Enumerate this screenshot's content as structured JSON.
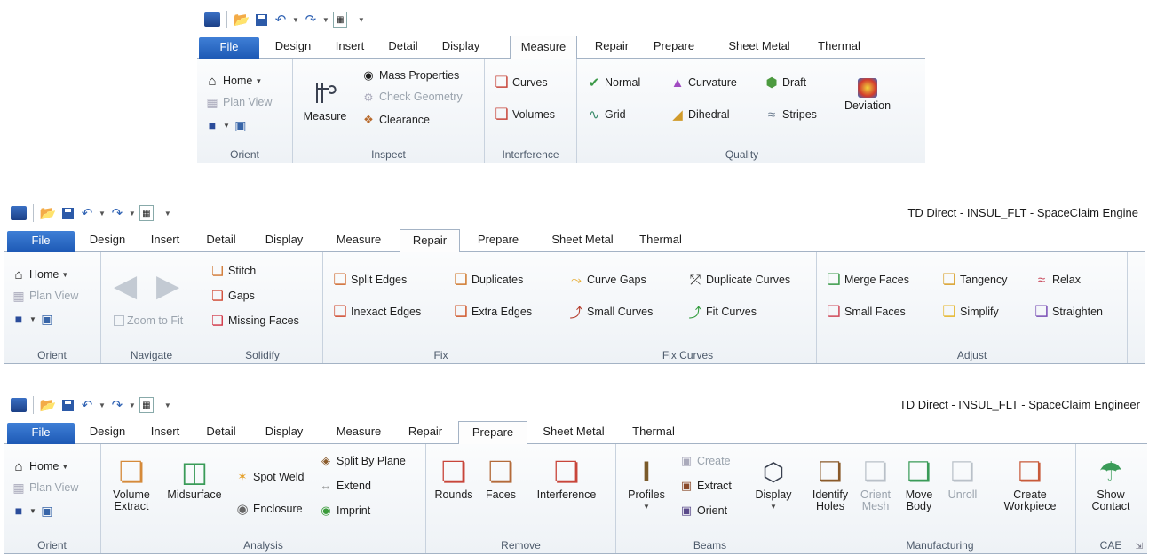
{
  "colors": {
    "file_tab": "#2a67c4",
    "ribbon_bg": "#f3f6f9",
    "border": "#a4b3c5"
  },
  "qat": {
    "save_icon": "save-icon",
    "undo_icon": "undo-icon",
    "redo_icon": "redo-icon"
  },
  "tabs": [
    "File",
    "Design",
    "Insert",
    "Detail",
    "Display",
    "Measure",
    "Repair",
    "Prepare",
    "Sheet Metal",
    "Thermal"
  ],
  "orient": {
    "home": "Home",
    "plan_view": "Plan View",
    "label": "Orient"
  },
  "s1": {
    "inspect": {
      "measure": "Measure",
      "mass_properties": "Mass Properties",
      "check_geometry": "Check Geometry",
      "clearance": "Clearance",
      "label": "Inspect"
    },
    "interference": {
      "curves": "Curves",
      "volumes": "Volumes",
      "label": "Interference"
    },
    "quality": {
      "normal": "Normal",
      "grid": "Grid",
      "curvature": "Curvature",
      "dihedral": "Dihedral",
      "draft": "Draft",
      "stripes": "Stripes",
      "deviation": "Deviation",
      "label": "Quality"
    }
  },
  "s2": {
    "title": "TD Direct - INSUL_FLT - SpaceClaim Engine",
    "navigate": {
      "zoom_to_fit": "Zoom to Fit",
      "label": "Navigate"
    },
    "solidify": {
      "stitch": "Stitch",
      "gaps": "Gaps",
      "missing_faces": "Missing Faces",
      "label": "Solidify"
    },
    "fix": {
      "split_edges": "Split Edges",
      "inexact_edges": "Inexact Edges",
      "duplicates": "Duplicates",
      "extra_edges": "Extra Edges",
      "label": "Fix"
    },
    "fix_curves": {
      "curve_gaps": "Curve Gaps",
      "small_curves": "Small Curves",
      "duplicate_curves": "Duplicate Curves",
      "fit_curves": "Fit Curves",
      "label": "Fix Curves"
    },
    "adjust": {
      "merge_faces": "Merge Faces",
      "small_faces": "Small Faces",
      "tangency": "Tangency",
      "simplify": "Simplify",
      "relax": "Relax",
      "straighten": "Straighten",
      "label": "Adjust"
    }
  },
  "s3": {
    "title": "TD Direct - INSUL_FLT - SpaceClaim Engineer",
    "analysis": {
      "volume": "Volume",
      "extract": "Extract",
      "midsurface": "Midsurface",
      "spot_weld": "Spot Weld",
      "enclosure": "Enclosure",
      "split_by_plane": "Split By Plane",
      "extend": "Extend",
      "imprint": "Imprint",
      "label": "Analysis"
    },
    "remove": {
      "rounds": "Rounds",
      "faces": "Faces",
      "interference": "Interference",
      "label": "Remove"
    },
    "beams": {
      "profiles": "Profiles",
      "create": "Create",
      "extract": "Extract",
      "orient": "Orient",
      "display": "Display",
      "label": "Beams"
    },
    "manufacturing": {
      "identify": "Identify",
      "holes": "Holes",
      "orient": "Orient",
      "mesh": "Mesh",
      "move": "Move",
      "body": "Body",
      "unroll": "Unroll",
      "create": "Create",
      "workpiece": "Workpiece",
      "label": "Manufacturing"
    },
    "cae": {
      "show": "Show",
      "contact": "Contact",
      "label": "CAE"
    }
  }
}
